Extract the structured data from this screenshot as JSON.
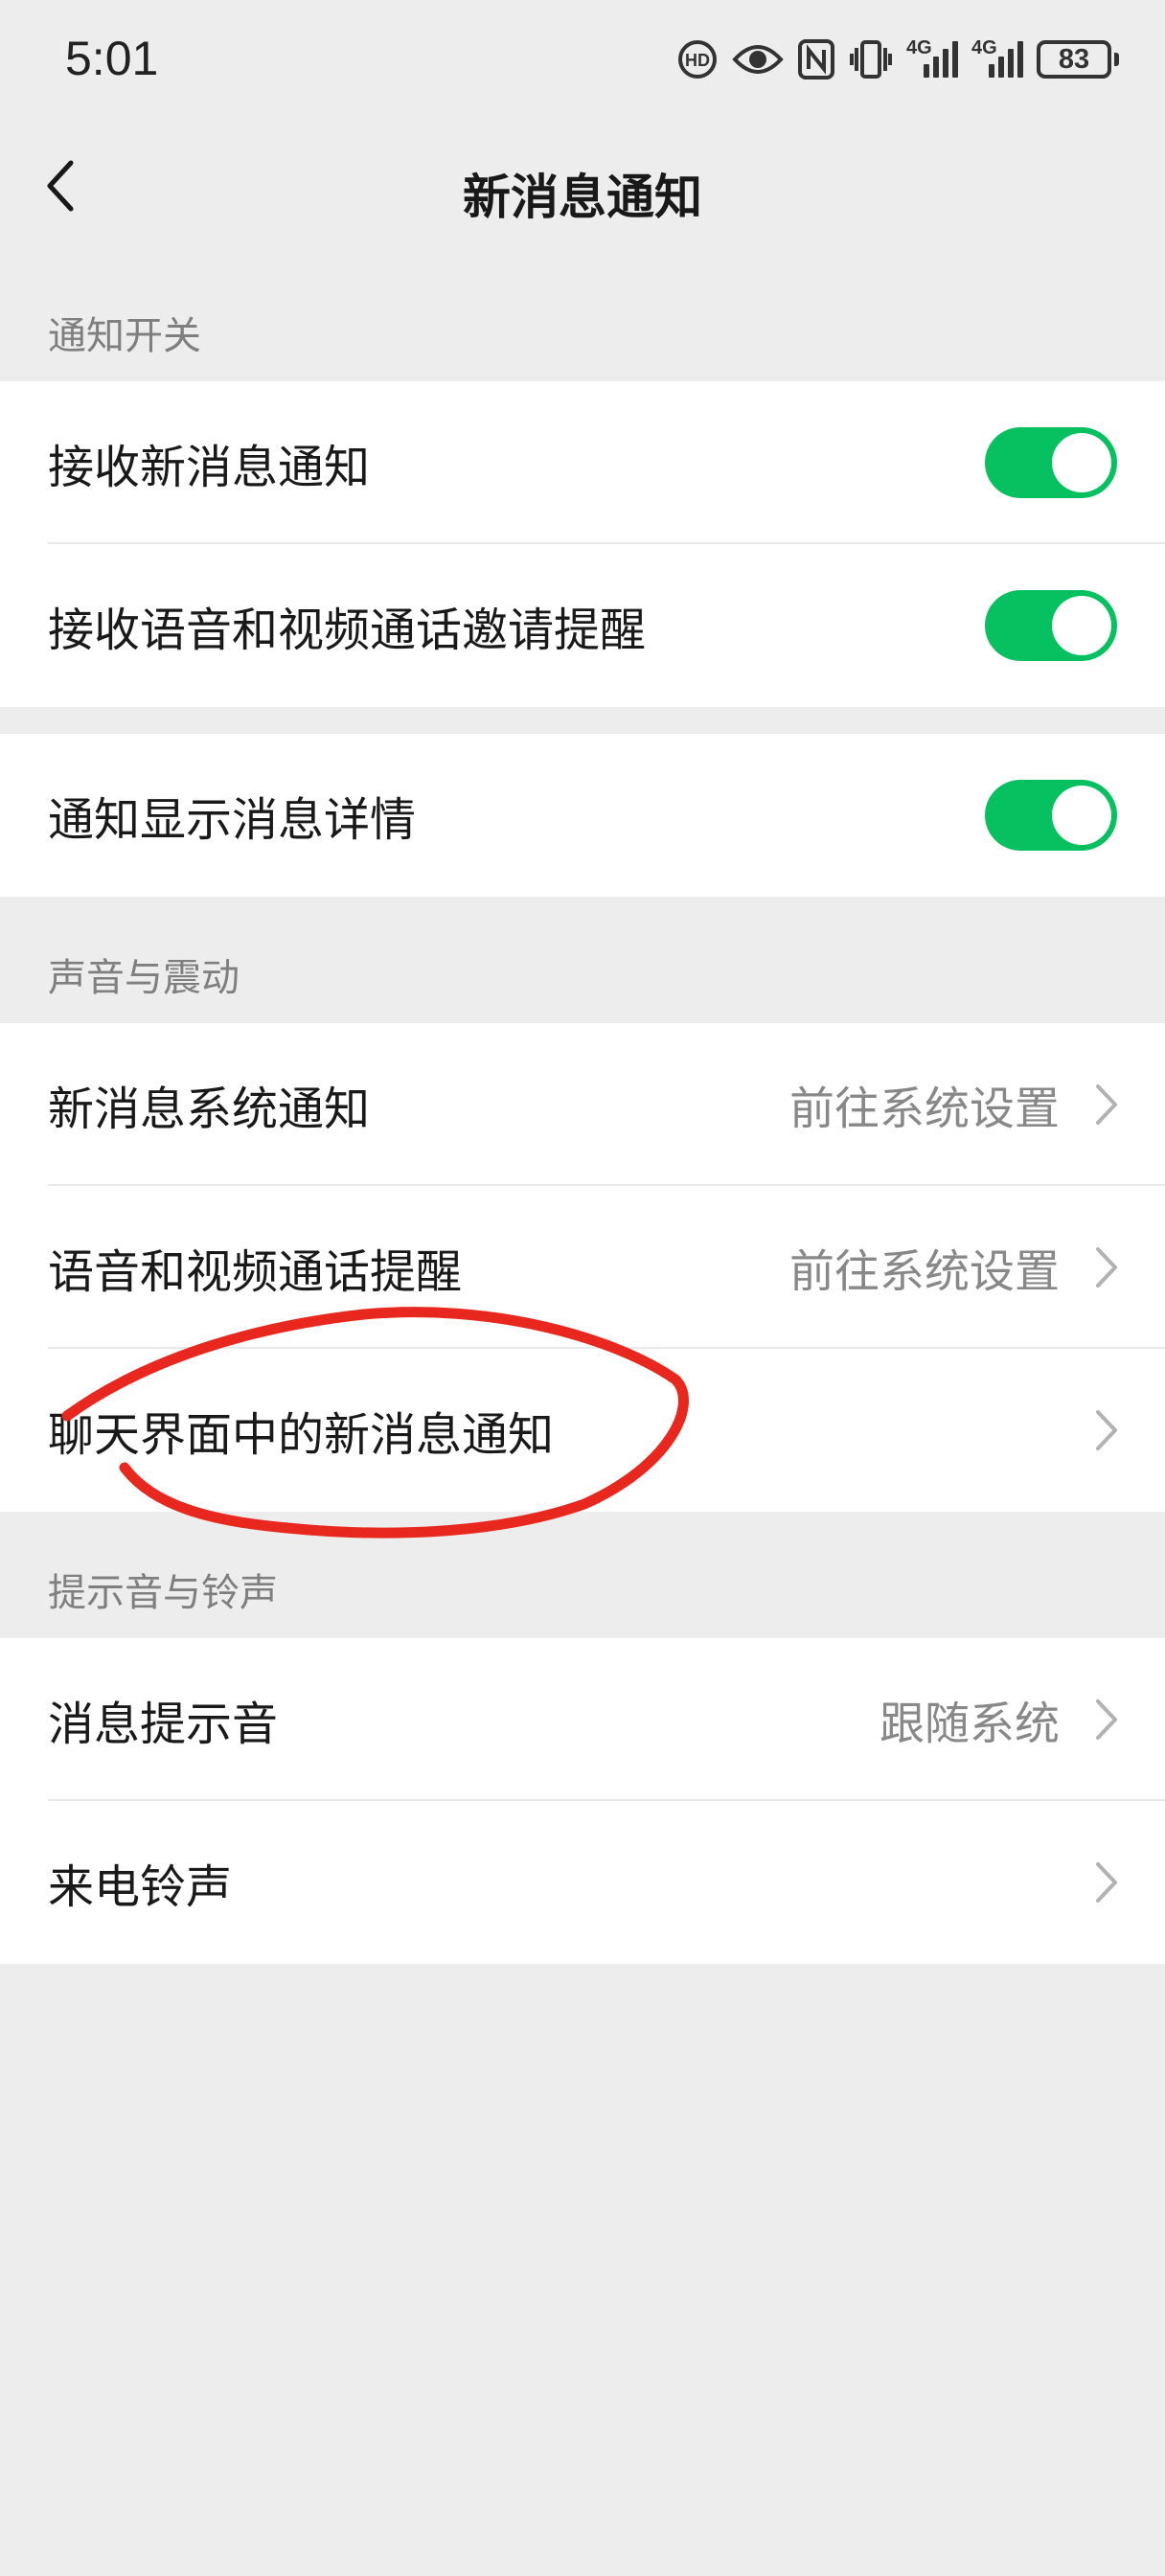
{
  "status_bar": {
    "time": "5:01",
    "battery_level": "83",
    "network_1": "4G",
    "network_2": "4G",
    "icons": [
      "hd-call-icon",
      "eye-icon",
      "nfc-icon",
      "vibrate-icon",
      "signal-icon",
      "signal-icon",
      "battery-icon"
    ]
  },
  "nav": {
    "title": "新消息通知",
    "back_icon": "chevron-left-icon"
  },
  "sections": {
    "notification_switch": {
      "header": "通知开关",
      "rows": [
        {
          "label": "接收新消息通知",
          "toggle_on": true
        },
        {
          "label": "接收语音和视频通话邀请提醒",
          "toggle_on": true
        }
      ],
      "detail_rows": [
        {
          "label": "通知显示消息详情",
          "toggle_on": true
        }
      ]
    },
    "sound_vibration": {
      "header": "声音与震动",
      "rows": [
        {
          "label": "新消息系统通知",
          "value": "前往系统设置"
        },
        {
          "label": "语音和视频通话提醒",
          "value": "前往系统设置"
        },
        {
          "label": "聊天界面中的新消息通知",
          "value": ""
        }
      ]
    },
    "tones": {
      "header": "提示音与铃声",
      "rows": [
        {
          "label": "消息提示音",
          "value": "跟随系统"
        },
        {
          "label": "来电铃声",
          "value": ""
        }
      ]
    }
  },
  "colors": {
    "toggle_on": "#07c160",
    "background": "#ededed",
    "annotation": "#e8281f"
  }
}
